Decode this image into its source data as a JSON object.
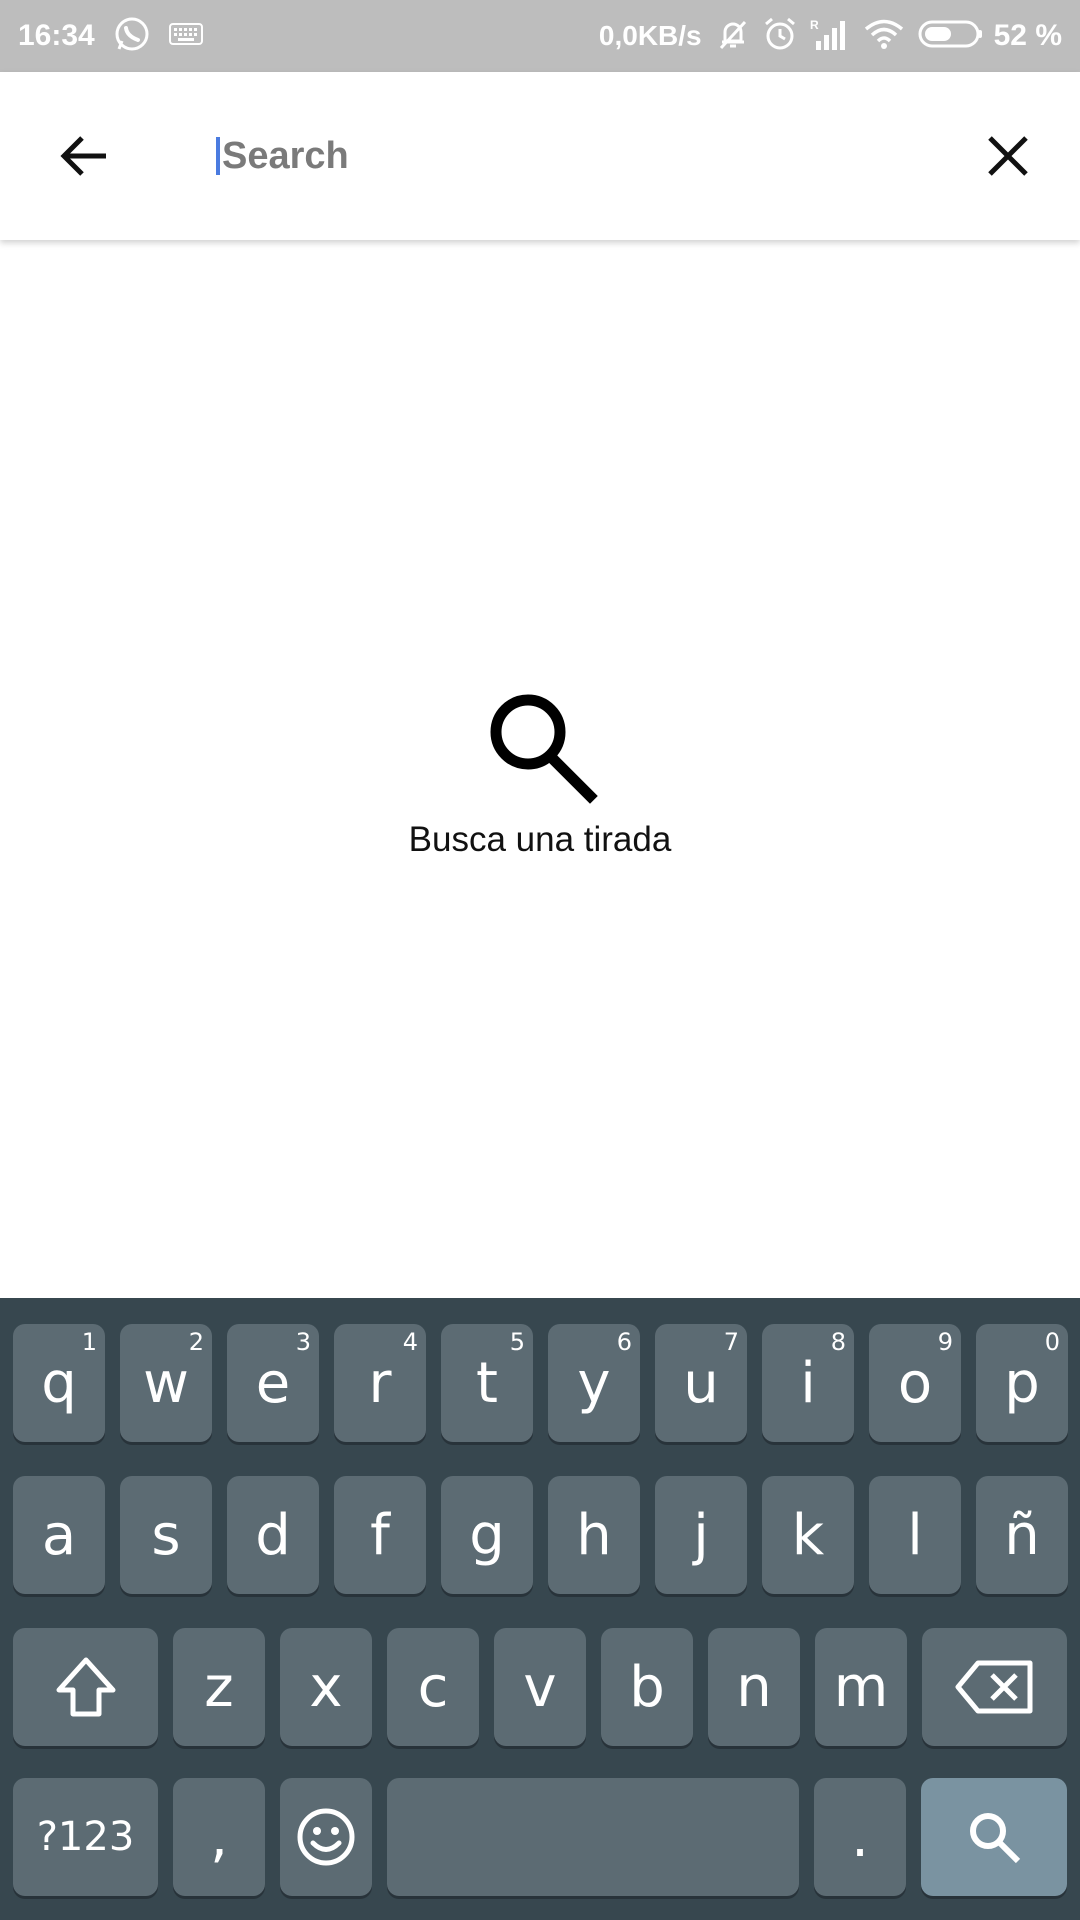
{
  "status_bar": {
    "time": "16:34",
    "network_speed": "0,0KB/s",
    "battery_percent": "52 %",
    "icons": [
      "whatsapp-icon",
      "keyboard-icon",
      "bell-off-icon",
      "alarm-icon",
      "signal-icon",
      "wifi-icon",
      "battery-icon"
    ]
  },
  "header": {
    "search_placeholder": "Search",
    "search_value": "",
    "back_icon": "arrow-back-icon",
    "clear_icon": "close-icon"
  },
  "empty_state": {
    "icon": "search-icon",
    "message": "Busca una tirada"
  },
  "keyboard": {
    "row1": [
      {
        "key": "q",
        "hint": "1"
      },
      {
        "key": "w",
        "hint": "2"
      },
      {
        "key": "e",
        "hint": "3"
      },
      {
        "key": "r",
        "hint": "4"
      },
      {
        "key": "t",
        "hint": "5"
      },
      {
        "key": "y",
        "hint": "6"
      },
      {
        "key": "u",
        "hint": "7"
      },
      {
        "key": "i",
        "hint": "8"
      },
      {
        "key": "o",
        "hint": "9"
      },
      {
        "key": "p",
        "hint": "0"
      }
    ],
    "row2": [
      "a",
      "s",
      "d",
      "f",
      "g",
      "h",
      "j",
      "k",
      "l",
      "ñ"
    ],
    "row3": [
      "z",
      "x",
      "c",
      "v",
      "b",
      "n",
      "m"
    ],
    "symbols_label": "?123",
    "comma_label": ",",
    "period_label": ".",
    "colors": {
      "background": "#37474f",
      "key": "#5c6b73",
      "action_key": "#7a93a1"
    }
  }
}
